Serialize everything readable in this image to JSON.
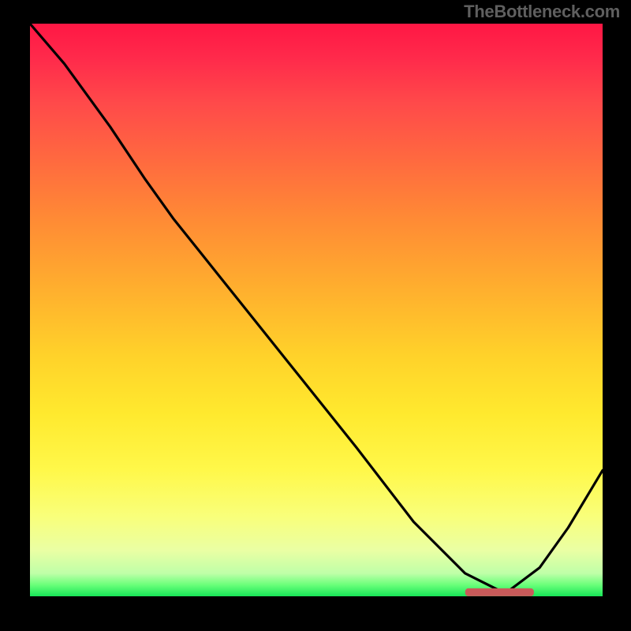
{
  "attribution": "TheBottleneck.com",
  "chart_data": {
    "type": "line",
    "title": "",
    "xlabel": "",
    "ylabel": "",
    "xlim": [
      0,
      100
    ],
    "ylim": [
      0,
      100
    ],
    "series": [
      {
        "name": "bottleneck-curve",
        "x": [
          0,
          6,
          14,
          20,
          25,
          33,
          45,
          57,
          67,
          76,
          83,
          89,
          94,
          100
        ],
        "values": [
          100,
          93,
          82,
          73,
          66,
          56,
          41,
          26,
          13,
          4,
          0.5,
          5,
          12,
          22
        ]
      }
    ],
    "marker": {
      "name": "highlight-strip",
      "x_start": 76,
      "x_end": 88,
      "y": 0.7
    },
    "background": {
      "type": "vertical-gradient",
      "stops": [
        {
          "pos": 0,
          "color": "#ff1744"
        },
        {
          "pos": 46,
          "color": "#ffd22a"
        },
        {
          "pos": 86,
          "color": "#eaffa4"
        },
        {
          "pos": 100,
          "color": "#17e657"
        }
      ]
    }
  }
}
